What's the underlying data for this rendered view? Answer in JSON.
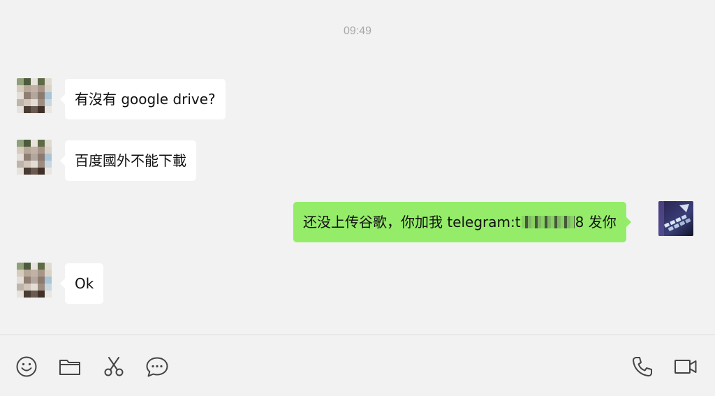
{
  "chat": {
    "timestamp": "09:49",
    "messages": [
      {
        "direction": "incoming",
        "text": "有沒有 google drive?"
      },
      {
        "direction": "incoming",
        "text": "百度國外不能下載"
      },
      {
        "direction": "outgoing",
        "text_before": "还没上传谷歌，你加我 telegram:t",
        "text_after": "8 发你"
      },
      {
        "direction": "incoming",
        "text": "Ok"
      }
    ]
  },
  "toolbar": {
    "left_icons": [
      "emoji-icon",
      "folder-icon",
      "scissors-icon",
      "chat-bubble-icon"
    ],
    "right_icons": [
      "phone-icon",
      "video-camera-icon"
    ]
  },
  "colors": {
    "background": "#f2f2f2",
    "incoming_bubble": "#ffffff",
    "outgoing_bubble": "#95ec69",
    "timestamp": "#a8a8a8",
    "icon": "#444444"
  }
}
